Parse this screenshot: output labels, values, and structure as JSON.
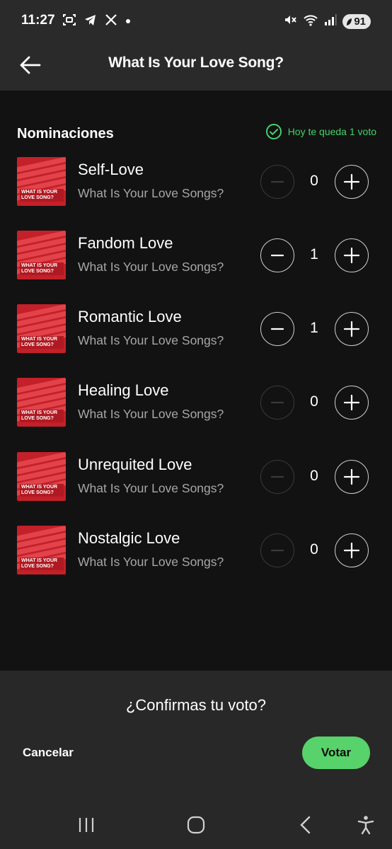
{
  "status_bar": {
    "time": "11:27",
    "battery": "91"
  },
  "header": {
    "title": "What Is Your Love Song?"
  },
  "section": {
    "title": "Nominaciones",
    "votes_left": "Hoy te queda 1 voto"
  },
  "nominees": [
    {
      "name": "Self-Love",
      "subtitle": "What Is Your Love Songs?",
      "count": "0",
      "minus_enabled": false
    },
    {
      "name": "Fandom Love",
      "subtitle": "What Is Your Love Songs?",
      "count": "1",
      "minus_enabled": true
    },
    {
      "name": "Romantic Love",
      "subtitle": "What Is Your Love Songs?",
      "count": "1",
      "minus_enabled": true
    },
    {
      "name": "Healing Love",
      "subtitle": "What Is Your Love Songs?",
      "count": "0",
      "minus_enabled": false
    },
    {
      "name": "Unrequited Love",
      "subtitle": "What Is Your Love Songs?",
      "count": "0",
      "minus_enabled": false
    },
    {
      "name": "Nostalgic Love",
      "subtitle": "What Is Your Love Songs?",
      "count": "0",
      "minus_enabled": false
    }
  ],
  "cover_text": "WHAT IS YOUR LOVE SONG?",
  "confirm": {
    "question": "¿Confirmas tu voto?",
    "cancel_label": "Cancelar",
    "vote_label": "Votar"
  },
  "colors": {
    "accent_green": "#58d26b",
    "background": "#121212",
    "panel": "#282828",
    "cover_red": "#c4202a"
  }
}
